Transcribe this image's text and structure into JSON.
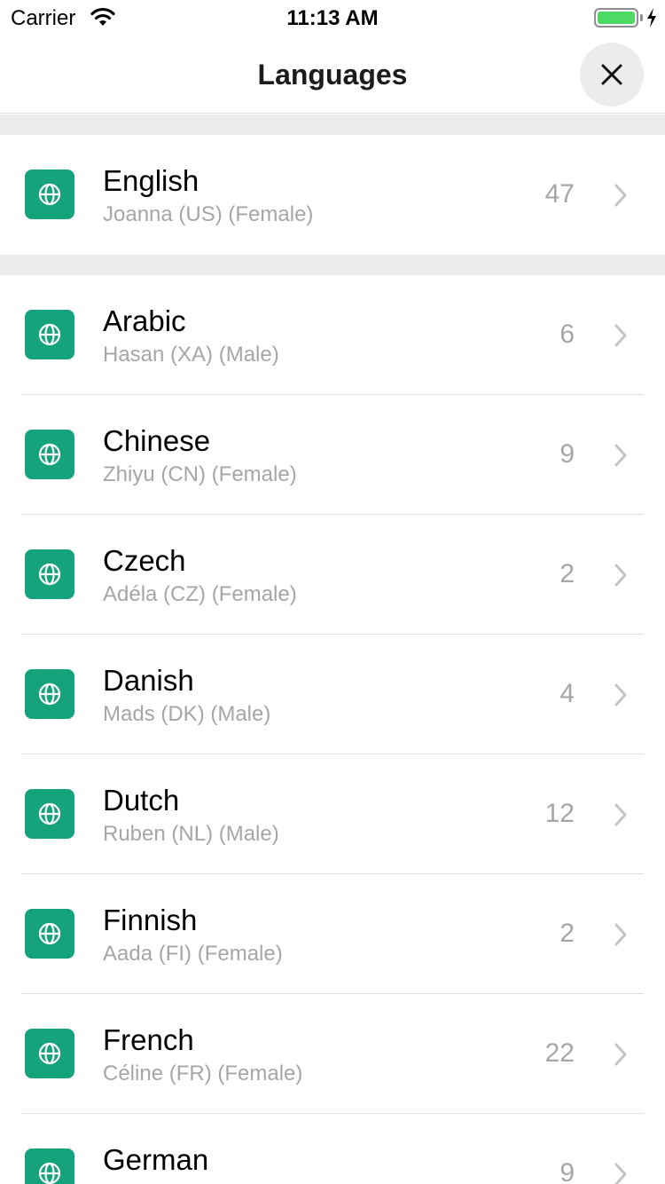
{
  "status_bar": {
    "carrier": "Carrier",
    "time": "11:13 AM",
    "battery_level": 1.0,
    "battery_color": "#4cd964",
    "icons": [
      "wifi-icon",
      "battery-icon",
      "charging-bolt-icon"
    ]
  },
  "nav": {
    "title": "Languages",
    "close_icon": "close-icon"
  },
  "accent_color": "#14a37a",
  "featured": {
    "name": "English",
    "voice": "Joanna (US) (Female)",
    "count": "47",
    "icon": "globe-icon"
  },
  "languages": [
    {
      "name": "Arabic",
      "voice": "Hasan (XA) (Male)",
      "count": "6",
      "icon": "globe-icon"
    },
    {
      "name": "Chinese",
      "voice": "Zhiyu (CN) (Female)",
      "count": "9",
      "icon": "globe-icon"
    },
    {
      "name": "Czech",
      "voice": "Adéla (CZ) (Female)",
      "count": "2",
      "icon": "globe-icon"
    },
    {
      "name": "Danish",
      "voice": "Mads (DK) (Male)",
      "count": "4",
      "icon": "globe-icon"
    },
    {
      "name": "Dutch",
      "voice": "Ruben (NL) (Male)",
      "count": "12",
      "icon": "globe-icon"
    },
    {
      "name": "Finnish",
      "voice": "Aada (FI) (Female)",
      "count": "2",
      "icon": "globe-icon"
    },
    {
      "name": "French",
      "voice": "Céline (FR) (Female)",
      "count": "22",
      "icon": "globe-icon"
    },
    {
      "name": "German",
      "voice": "",
      "count": "9",
      "icon": "globe-icon"
    }
  ]
}
